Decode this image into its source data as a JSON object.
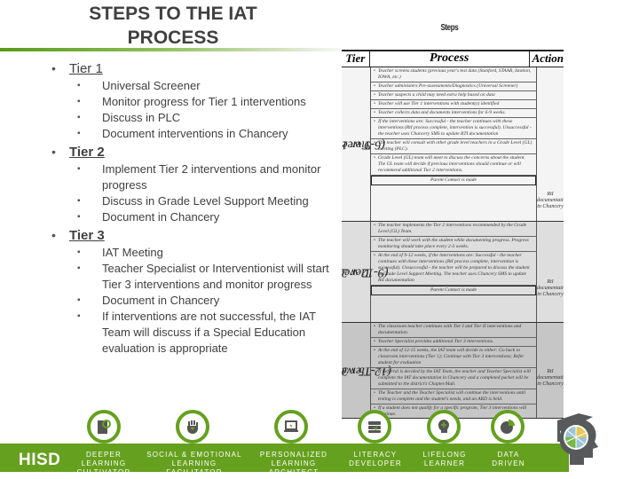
{
  "slide": {
    "title": "STEPS TO THE IAT PROCESS",
    "accent_color": "#65a01e"
  },
  "outline": {
    "tiers": [
      {
        "label": "Tier 1",
        "items": [
          "Universal Screener",
          "Monitor progress for Tier 1 interventions",
          "Discuss in PLC",
          "Document interventions in Chancery"
        ]
      },
      {
        "label": "Tier 2",
        "items": [
          "Implement Tier 2 interventions and monitor progress",
          "Discuss in Grade Level Support Meeting",
          "Document in Chancery"
        ]
      },
      {
        "label": "Tier 3",
        "items": [
          "IAT Meeting",
          "Teacher Specialist or Interventionist will start Tier 3 interventions and monitor progress",
          "Document in Chancery",
          "If interventions are not successful, the IAT Team will discuss if a Special Education evaluation is appropriate"
        ]
      }
    ]
  },
  "steps_table": {
    "caption": "Steps",
    "headers": [
      "Tier",
      "Process",
      "Action"
    ],
    "tiers": [
      {
        "name": "Tier 1",
        "duration": "(6-9 weeks)",
        "rows": [
          "Teacher screens students (previous year's test data (Stanford, STAAR, Istation, IOWA, etc.)",
          "Teacher administers Pre-assessments/Diagnostics (Universal Screener)",
          "Teacher suspects a child may need extra help based on data",
          "Teacher will use Tier 1 interventions with student(s) identified",
          "Teacher collects data and documents interventions for 6-9 weeks.",
          "If the interventions are: Successful - the teacher continues with these interventions (RtI process complete, intervention is successful). Unsuccessful - the teacher uses Chancery SMS to update RTI documentation",
          "The teacher will consult with other grade level teachers in a Grade Level (GL) meeting (PLC).",
          "Grade Level (GL) team will meet to discuss the concerns about the student. The GL team will decide if previous interventions should continue or will recommend additional Tier 2 interventions."
        ],
        "boxed_row": "Parent Contact is made",
        "action_note": "RtI documentation in Chancery"
      },
      {
        "name": "Tier 2",
        "duration": "(9-12 weeks)",
        "rows": [
          "The teacher implements the Tier 2 interventions recommended by the Grade Level (GL) Team.",
          "The teacher will work with the student while documenting progress. Progress monitoring should take place every 2-3 weeks.",
          "At the end of 9-12 weeks, if the interventions are: Successful - the teacher continues with these interventions (RtI process complete, intervention is successful). Unsuccessful - the teacher will be prepared to discuss the student at Grade Level Support Meeting. The teacher uses Chancery SMS to update RtI documentation"
        ],
        "boxed_row": "Parent Contact is made",
        "action_note": "RtI documentation in Chancery"
      },
      {
        "name": "Tier 3",
        "duration": "(12-15 weeks)",
        "rows": [
          "The classroom teacher continues with Tier I and Tier II interventions and documentation.",
          "Teacher Specialist provides additional Tier 3 interventions.",
          "At the end of 12-15 weeks, the IAT team will decide to either: Go back to classroom interventions (Tier 1); Continue with Tier 3 interventions; Refer student for evaluation",
          "If Referral is decided by the IAT Team, the teacher and Teacher Specialist will complete the IAT documentation in Chancery and a completed packet will be submitted to the district's Chapter/Hub.",
          "The Teacher and the Teacher Specialist will continue the interventions until testing is complete and the student's needs, and an ARD is held.",
          "If a student does not qualify for a specific program, Tier 3 interventions will continue."
        ],
        "action_note": "RtI documentation in Chancery"
      }
    ]
  },
  "footer": {
    "brand": "HISD",
    "badges": [
      {
        "icon": "book-search-icon",
        "label_line1": "DEEPER LEARNING",
        "label_line2": "CULTIVATOR"
      },
      {
        "icon": "hand-heart-icon",
        "label_line1": "SOCIAL & EMOTIONAL",
        "label_line2": "LEARNING FACILITATOR"
      },
      {
        "icon": "laptop-icon",
        "label_line1": "PERSONALIZED",
        "label_line2": "LEARNING ARCHITECT"
      },
      {
        "icon": "books-icon",
        "label_line1": "LITERACY",
        "label_line2": "DEVELOPER"
      },
      {
        "icon": "head-plus-icon",
        "label_line1": "LIFELONG",
        "label_line2": "LEARNER"
      },
      {
        "icon": "pie-chart-icon",
        "label_line1": "DATA",
        "label_line2": "DRIVEN"
      }
    ],
    "logo_icon": "graduate-head-globe-icon"
  }
}
